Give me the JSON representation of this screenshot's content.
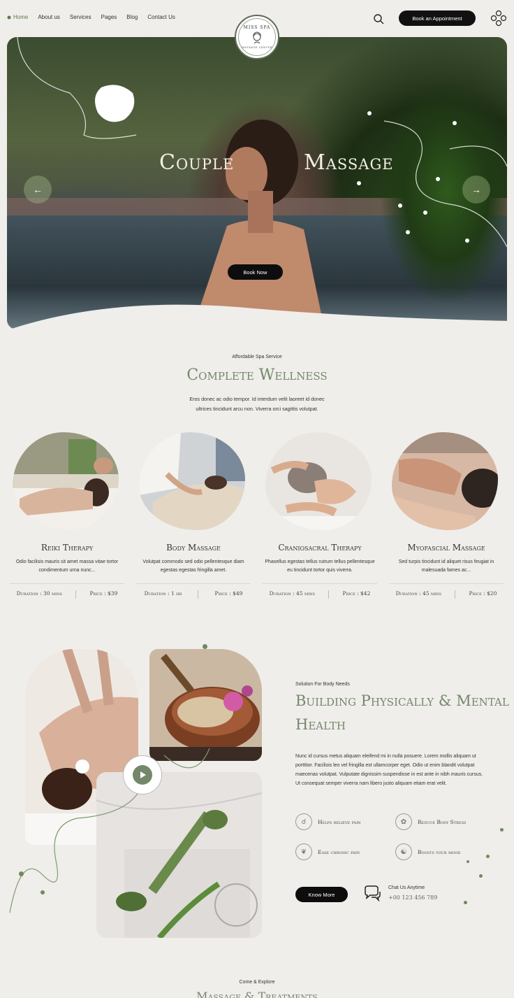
{
  "nav": {
    "items": [
      "Home",
      "About us",
      "Services",
      "Pages",
      "Blog",
      "Contact Us"
    ],
    "logo_name": "MISS SPA",
    "logo_sub": "MASSAGE CENTER",
    "book_label": "Book an Appointment"
  },
  "hero": {
    "title_left": "Couple",
    "title_right": "Massage",
    "book_label": "Book Now"
  },
  "wellness": {
    "eyebrow": "Affordable Spa Service",
    "title": "Complete Wellness",
    "desc_line1": "Eros donec ac odio tempor. Id interdum velit laoreet id donec",
    "desc_line2": "ultrices tincidunt arcu non. Viverra orci sagittis volutpat.",
    "cards": [
      {
        "title": "Reiki Therapy",
        "desc": "Odio facilisis mauris sit amet massa vitae tortor condimentum urna nunc...",
        "duration": "Duration : 30 mins",
        "price": "Price : $39"
      },
      {
        "title": "Body Massage",
        "desc": "Volutpat commodo sed odio pellentesque diam egestas egestas fringilla amet.",
        "duration": "Duration : 1 hr",
        "price": "Price : $49"
      },
      {
        "title": "Craniosacral Therapy",
        "desc": "Phasellus egestas tellus rutrum tellus pellentesque eu tincidunt tortor quis viverra.",
        "duration": "Duration : 45 mins",
        "price": "Price : $42"
      },
      {
        "title": "Myofascial Massage",
        "desc": "Sed turpis tincidunt id aliquet risus feugiat in malesuada fames ac...",
        "duration": "Duration : 45 mins",
        "price": "Price : $20"
      }
    ]
  },
  "health": {
    "eyebrow": "Solution For Body Needs",
    "title_line1": "Building Physically & Mental",
    "title_line2": "Health",
    "body": "Nunc id cursus metus aliquam eleifend mi in nulla posuere. Lorem mollis aliquam ut porttitor. Facilisis leo vel fringilla est ullamcorper eget. Odio ut enim blandit volutpat maecenas volutpat. Vulputate dignissim suspendisse in est ante in nibh mauris cursus. Ut consequat semper viverra nam libero justo aliquam etiam erat velit.",
    "features": [
      "Helps relieve pain",
      "Reduce Body Stress",
      "Ease chronic pain",
      "Boosts your mood"
    ],
    "know_label": "Know More",
    "chat_label": "Chat Us Anytime",
    "chat_phone": "+00 123 456 789"
  },
  "explore": {
    "eyebrow": "Come & Explore",
    "title": "Massage & Treatments"
  }
}
